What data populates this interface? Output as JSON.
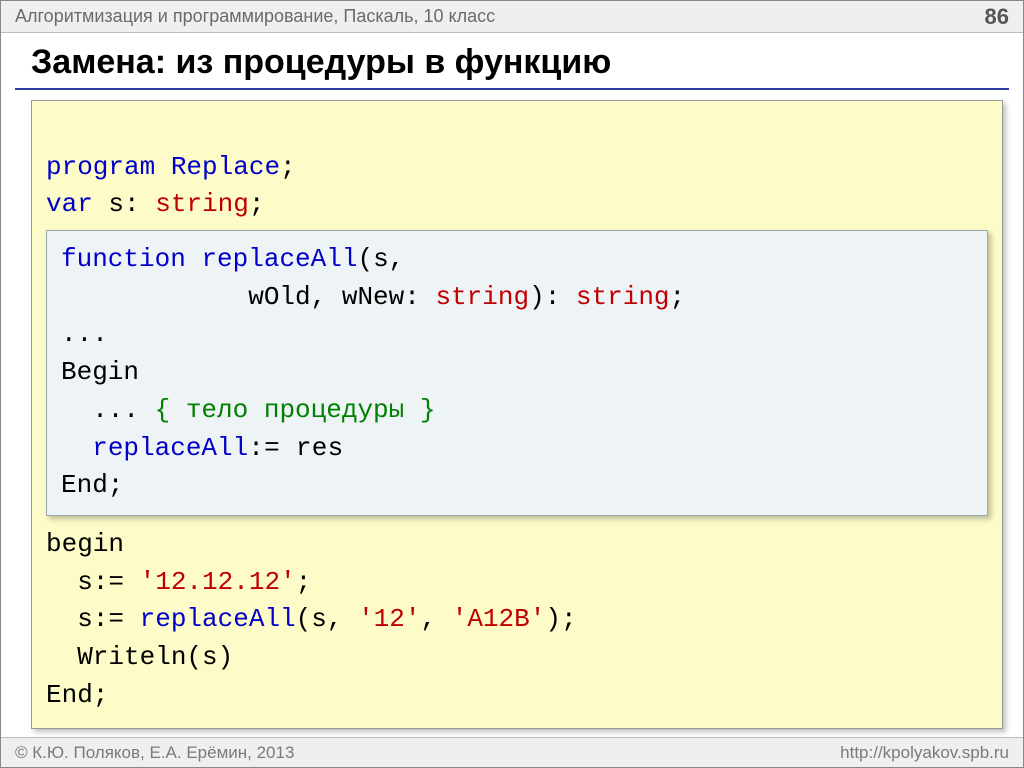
{
  "header": {
    "breadcrumb": "Алгоритмизация и программирование, Паскаль, 10 класс",
    "page": "86"
  },
  "title": "Замена: из процедуры в функцию",
  "code": {
    "l1_kw": "program",
    "l1_id": "Replace",
    "l1_tail": ";",
    "l2_kw": "var",
    "l2_var": " s: ",
    "l2_type": "string",
    "l2_tail": ";",
    "inner": {
      "l1_kw": "function",
      "l1_id": "replaceAll",
      "l1_tail": "(s,",
      "l2_pad": "            wOld, wNew: ",
      "l2_t1": "string",
      "l2_mid": "): ",
      "l2_t2": "string",
      "l2_tail": ";",
      "l3": "...",
      "l4": "Begin",
      "l5_pad": "  ... ",
      "l5_cmt": "{ тело процедуры }",
      "l6_pad": "  ",
      "l6_id": "replaceAll",
      "l6_tail": ":= res",
      "l7": "End;"
    },
    "l3": "begin",
    "l4_pad": "  s:= ",
    "l4_str": "'12.12.12'",
    "l4_tail": ";",
    "l5_pad": "  s:= ",
    "l5_id": "replaceAll",
    "l5_mid1": "(s, ",
    "l5_s1": "'12'",
    "l5_mid2": ", ",
    "l5_s2": "'A12B'",
    "l5_tail": ");",
    "l6": "  Writeln(s)",
    "l7": "End;"
  },
  "footer": {
    "left": "© К.Ю. Поляков, Е.А. Ерёмин, 2013",
    "right": "http://kpolyakov.spb.ru"
  }
}
